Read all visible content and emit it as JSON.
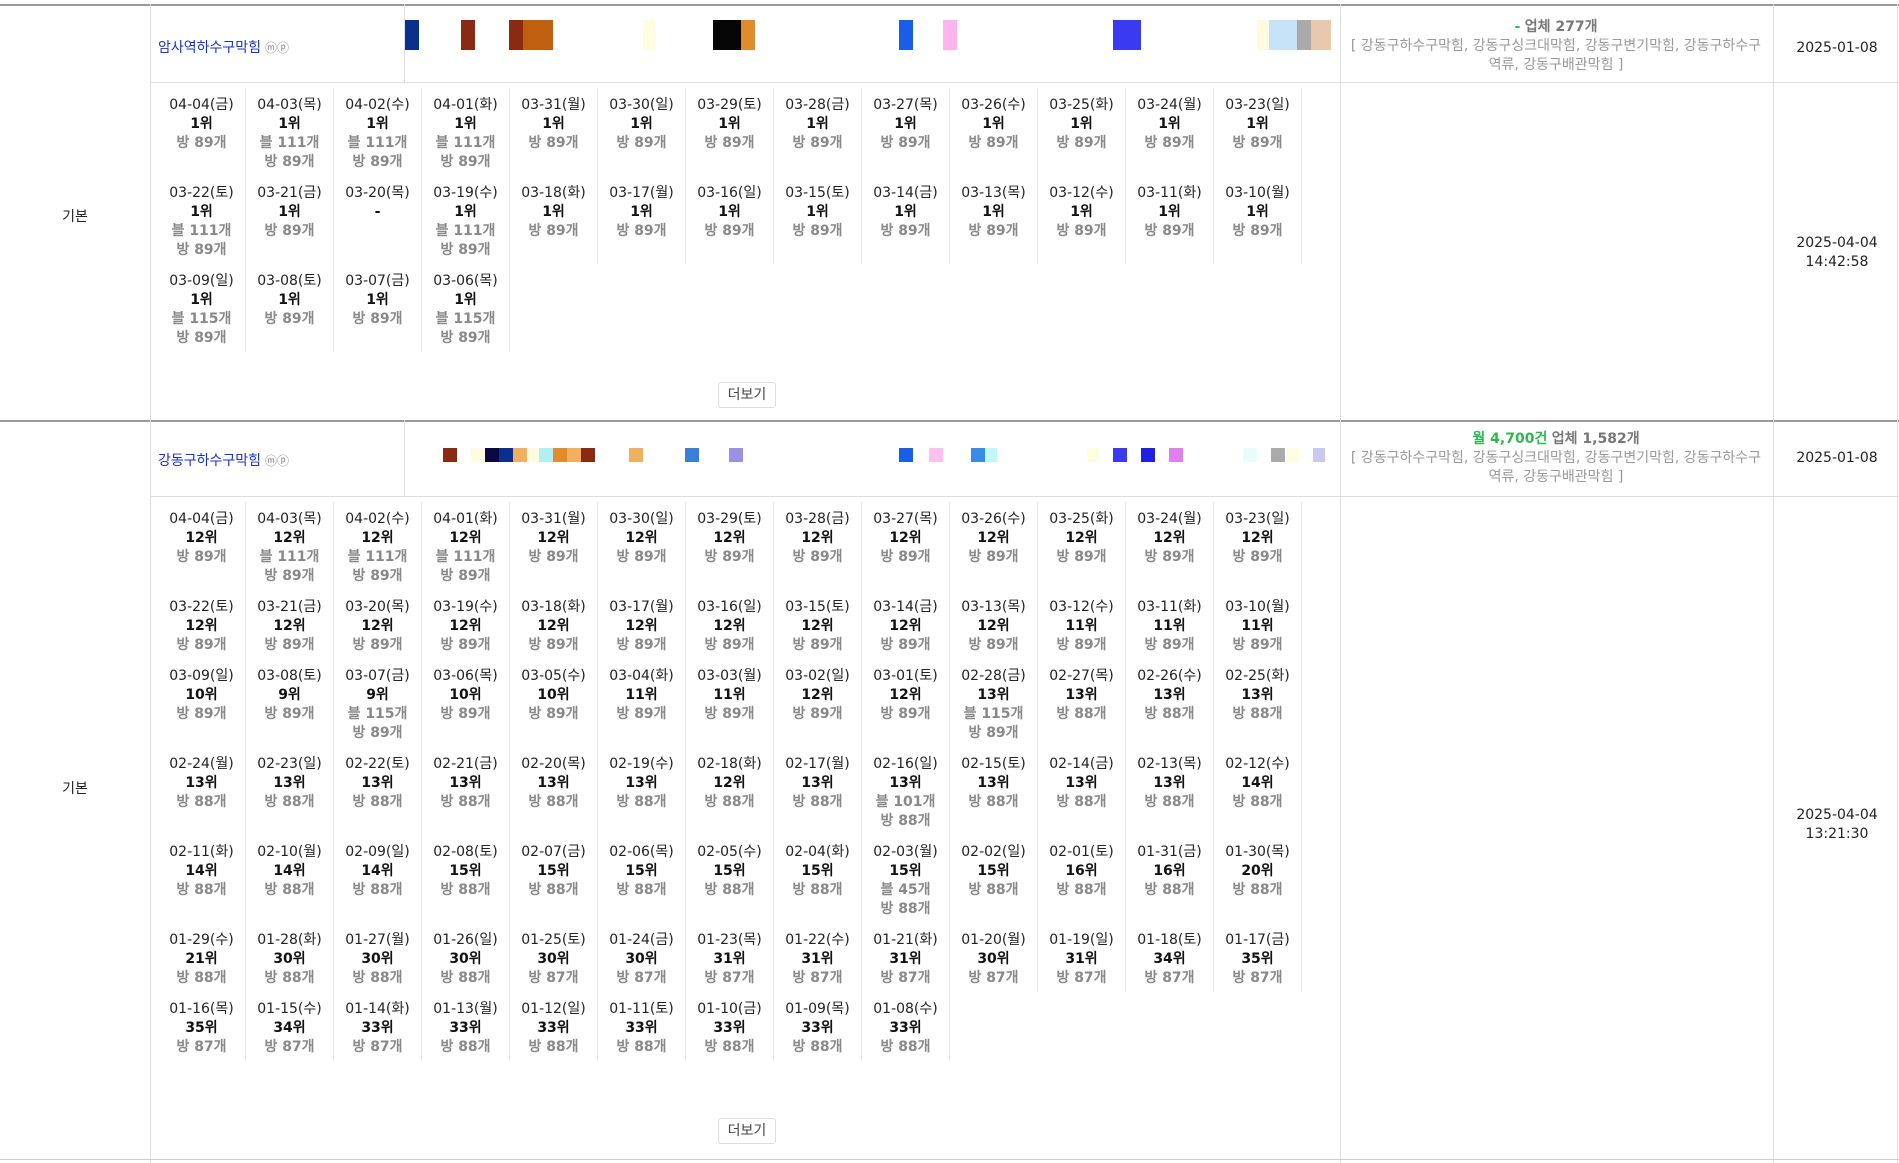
{
  "sections": [
    {
      "label": "기본",
      "keyword": "암사역하수구막힘",
      "mark": "ⓜⓟ",
      "summary_prefix": "-",
      "summary_count": "업체 277개",
      "tags": "[ 강동구하수구막힘, 강동구싱크대막힘, 강동구변기막힘, 강동구하수구역류, 강동구배관막힘 ]",
      "reg_date": "2025-01-08",
      "updated_date": "2025-04-04",
      "updated_time": "14:42:58",
      "more_label": "더보기",
      "strip": [
        {
          "c": "#0a2f8c",
          "w": 14,
          "o": 0
        },
        {
          "c": "#8b2a12",
          "w": 14,
          "o": 56
        },
        {
          "c": "#8b2a12",
          "w": 14,
          "o": 104
        },
        {
          "c": "#c0600e",
          "w": 30,
          "o": 118
        },
        {
          "c": "#fffde0",
          "w": 12,
          "o": 238
        },
        {
          "c": "#050505",
          "w": 28,
          "o": 308
        },
        {
          "c": "#e08b2c",
          "w": 14,
          "o": 336
        },
        {
          "c": "#1a5ee8",
          "w": 14,
          "o": 494
        },
        {
          "c": "#ffb3ef",
          "w": 14,
          "o": 538
        },
        {
          "c": "#3a3af0",
          "w": 28,
          "o": 708
        },
        {
          "c": "#fffbe0",
          "w": 12,
          "o": 852
        },
        {
          "c": "#c6e2f7",
          "w": 28,
          "o": 864
        },
        {
          "c": "#aaaaaa",
          "w": 14,
          "o": 892
        },
        {
          "c": "#e8c9b0",
          "w": 20,
          "o": 906
        }
      ],
      "cells": [
        {
          "d": "04-04(금)",
          "r": "1위",
          "l": [
            "방 89개"
          ]
        },
        {
          "d": "04-03(목)",
          "r": "1위",
          "l": [
            "블 111개",
            "방 89개"
          ]
        },
        {
          "d": "04-02(수)",
          "r": "1위",
          "l": [
            "블 111개",
            "방 89개"
          ]
        },
        {
          "d": "04-01(화)",
          "r": "1위",
          "l": [
            "블 111개",
            "방 89개"
          ]
        },
        {
          "d": "03-31(월)",
          "r": "1위",
          "l": [
            "방 89개"
          ]
        },
        {
          "d": "03-30(일)",
          "r": "1위",
          "l": [
            "방 89개"
          ]
        },
        {
          "d": "03-29(토)",
          "r": "1위",
          "l": [
            "방 89개"
          ]
        },
        {
          "d": "03-28(금)",
          "r": "1위",
          "l": [
            "방 89개"
          ]
        },
        {
          "d": "03-27(목)",
          "r": "1위",
          "l": [
            "방 89개"
          ]
        },
        {
          "d": "03-26(수)",
          "r": "1위",
          "l": [
            "방 89개"
          ]
        },
        {
          "d": "03-25(화)",
          "r": "1위",
          "l": [
            "방 89개"
          ]
        },
        {
          "d": "03-24(월)",
          "r": "1위",
          "l": [
            "방 89개"
          ]
        },
        {
          "d": "03-23(일)",
          "r": "1위",
          "l": [
            "방 89개"
          ]
        },
        {
          "d": "03-22(토)",
          "r": "1위",
          "l": [
            "블 111개",
            "방 89개"
          ]
        },
        {
          "d": "03-21(금)",
          "r": "1위",
          "l": [
            "방 89개"
          ]
        },
        {
          "d": "03-20(목)",
          "r": "-",
          "l": []
        },
        {
          "d": "03-19(수)",
          "r": "1위",
          "l": [
            "블 111개",
            "방 89개"
          ]
        },
        {
          "d": "03-18(화)",
          "r": "1위",
          "l": [
            "방 89개"
          ]
        },
        {
          "d": "03-17(월)",
          "r": "1위",
          "l": [
            "방 89개"
          ]
        },
        {
          "d": "03-16(일)",
          "r": "1위",
          "l": [
            "방 89개"
          ]
        },
        {
          "d": "03-15(토)",
          "r": "1위",
          "l": [
            "방 89개"
          ]
        },
        {
          "d": "03-14(금)",
          "r": "1위",
          "l": [
            "방 89개"
          ]
        },
        {
          "d": "03-13(목)",
          "r": "1위",
          "l": [
            "방 89개"
          ]
        },
        {
          "d": "03-12(수)",
          "r": "1위",
          "l": [
            "방 89개"
          ]
        },
        {
          "d": "03-11(화)",
          "r": "1위",
          "l": [
            "방 89개"
          ]
        },
        {
          "d": "03-10(월)",
          "r": "1위",
          "l": [
            "방 89개"
          ]
        },
        {
          "d": "03-09(일)",
          "r": "1위",
          "l": [
            "블 115개",
            "방 89개"
          ]
        },
        {
          "d": "03-08(토)",
          "r": "1위",
          "l": [
            "방 89개"
          ]
        },
        {
          "d": "03-07(금)",
          "r": "1위",
          "l": [
            "방 89개"
          ]
        },
        {
          "d": "03-06(목)",
          "r": "1위",
          "l": [
            "블 115개",
            "방 89개"
          ]
        }
      ]
    },
    {
      "label": "기본",
      "keyword": "강동구하수구막힘",
      "mark": "ⓜⓟ",
      "summary_prefix": "월 4,700건",
      "summary_count": "업체 1,582개",
      "tags": "[ 강동구하수구막힘, 강동구싱크대막힘, 강동구변기막힘, 강동구하수구역류, 강동구배관막힘 ]",
      "reg_date": "2025-01-08",
      "updated_date": "2025-04-04",
      "updated_time": "13:21:30",
      "more_label": "더보기",
      "strip": [
        {
          "c": "#8b2a12",
          "w": 14,
          "o": 38
        },
        {
          "c": "#fffbe0",
          "w": 14,
          "o": 66
        },
        {
          "c": "#0a0a40",
          "w": 14,
          "o": 80
        },
        {
          "c": "#0a2f8c",
          "w": 14,
          "o": 94
        },
        {
          "c": "#f0b060",
          "w": 14,
          "o": 108
        },
        {
          "c": "#fffbe0",
          "w": 12,
          "o": 122
        },
        {
          "c": "#b0f0f0",
          "w": 14,
          "o": 134
        },
        {
          "c": "#e08b2c",
          "w": 14,
          "o": 148
        },
        {
          "c": "#f0b060",
          "w": 14,
          "o": 162
        },
        {
          "c": "#8b2a12",
          "w": 14,
          "o": 176
        },
        {
          "c": "#f0b060",
          "w": 14,
          "o": 224
        },
        {
          "c": "#3a80d8",
          "w": 14,
          "o": 280
        },
        {
          "c": "#9a90e8",
          "w": 14,
          "o": 324
        },
        {
          "c": "#1a5ee8",
          "w": 14,
          "o": 494
        },
        {
          "c": "#ffc0f0",
          "w": 14,
          "o": 524
        },
        {
          "c": "#3a8ae8",
          "w": 14,
          "o": 566
        },
        {
          "c": "#c0f8f8",
          "w": 12,
          "o": 580
        },
        {
          "c": "#fffde0",
          "w": 12,
          "o": 682
        },
        {
          "c": "#3a3af0",
          "w": 14,
          "o": 708
        },
        {
          "c": "#2020e0",
          "w": 14,
          "o": 736
        },
        {
          "c": "#e080f0",
          "w": 14,
          "o": 764
        },
        {
          "c": "#e8fcfc",
          "w": 14,
          "o": 838
        },
        {
          "c": "#aaaaaa",
          "w": 14,
          "o": 866
        },
        {
          "c": "#fffde0",
          "w": 12,
          "o": 882
        },
        {
          "c": "#c8c8f0",
          "w": 12,
          "o": 908
        }
      ],
      "cells": [
        {
          "d": "04-04(금)",
          "r": "12위",
          "l": [
            "방 89개"
          ]
        },
        {
          "d": "04-03(목)",
          "r": "12위",
          "l": [
            "블 111개",
            "방 89개"
          ]
        },
        {
          "d": "04-02(수)",
          "r": "12위",
          "l": [
            "블 111개",
            "방 89개"
          ]
        },
        {
          "d": "04-01(화)",
          "r": "12위",
          "l": [
            "블 111개",
            "방 89개"
          ]
        },
        {
          "d": "03-31(월)",
          "r": "12위",
          "l": [
            "방 89개"
          ]
        },
        {
          "d": "03-30(일)",
          "r": "12위",
          "l": [
            "방 89개"
          ]
        },
        {
          "d": "03-29(토)",
          "r": "12위",
          "l": [
            "방 89개"
          ]
        },
        {
          "d": "03-28(금)",
          "r": "12위",
          "l": [
            "방 89개"
          ]
        },
        {
          "d": "03-27(목)",
          "r": "12위",
          "l": [
            "방 89개"
          ]
        },
        {
          "d": "03-26(수)",
          "r": "12위",
          "l": [
            "방 89개"
          ]
        },
        {
          "d": "03-25(화)",
          "r": "12위",
          "l": [
            "방 89개"
          ]
        },
        {
          "d": "03-24(월)",
          "r": "12위",
          "l": [
            "방 89개"
          ]
        },
        {
          "d": "03-23(일)",
          "r": "12위",
          "l": [
            "방 89개"
          ]
        },
        {
          "d": "03-22(토)",
          "r": "12위",
          "l": [
            "방 89개"
          ]
        },
        {
          "d": "03-21(금)",
          "r": "12위",
          "l": [
            "방 89개"
          ]
        },
        {
          "d": "03-20(목)",
          "r": "12위",
          "l": [
            "방 89개"
          ]
        },
        {
          "d": "03-19(수)",
          "r": "12위",
          "l": [
            "방 89개"
          ]
        },
        {
          "d": "03-18(화)",
          "r": "12위",
          "l": [
            "방 89개"
          ]
        },
        {
          "d": "03-17(월)",
          "r": "12위",
          "l": [
            "방 89개"
          ]
        },
        {
          "d": "03-16(일)",
          "r": "12위",
          "l": [
            "방 89개"
          ]
        },
        {
          "d": "03-15(토)",
          "r": "12위",
          "l": [
            "방 89개"
          ]
        },
        {
          "d": "03-14(금)",
          "r": "12위",
          "l": [
            "방 89개"
          ]
        },
        {
          "d": "03-13(목)",
          "r": "12위",
          "l": [
            "방 89개"
          ]
        },
        {
          "d": "03-12(수)",
          "r": "11위",
          "l": [
            "방 89개"
          ]
        },
        {
          "d": "03-11(화)",
          "r": "11위",
          "l": [
            "방 89개"
          ]
        },
        {
          "d": "03-10(월)",
          "r": "11위",
          "l": [
            "방 89개"
          ]
        },
        {
          "d": "03-09(일)",
          "r": "10위",
          "l": [
            "방 89개"
          ]
        },
        {
          "d": "03-08(토)",
          "r": "9위",
          "l": [
            "방 89개"
          ]
        },
        {
          "d": "03-07(금)",
          "r": "9위",
          "l": [
            "블 115개",
            "방 89개"
          ]
        },
        {
          "d": "03-06(목)",
          "r": "10위",
          "l": [
            "방 89개"
          ]
        },
        {
          "d": "03-05(수)",
          "r": "10위",
          "l": [
            "방 89개"
          ]
        },
        {
          "d": "03-04(화)",
          "r": "11위",
          "l": [
            "방 89개"
          ]
        },
        {
          "d": "03-03(월)",
          "r": "11위",
          "l": [
            "방 89개"
          ]
        },
        {
          "d": "03-02(일)",
          "r": "12위",
          "l": [
            "방 89개"
          ]
        },
        {
          "d": "03-01(토)",
          "r": "12위",
          "l": [
            "방 89개"
          ]
        },
        {
          "d": "02-28(금)",
          "r": "13위",
          "l": [
            "블 115개",
            "방 89개"
          ]
        },
        {
          "d": "02-27(목)",
          "r": "13위",
          "l": [
            "방 88개"
          ]
        },
        {
          "d": "02-26(수)",
          "r": "13위",
          "l": [
            "방 88개"
          ]
        },
        {
          "d": "02-25(화)",
          "r": "13위",
          "l": [
            "방 88개"
          ]
        },
        {
          "d": "02-24(월)",
          "r": "13위",
          "l": [
            "방 88개"
          ]
        },
        {
          "d": "02-23(일)",
          "r": "13위",
          "l": [
            "방 88개"
          ]
        },
        {
          "d": "02-22(토)",
          "r": "13위",
          "l": [
            "방 88개"
          ]
        },
        {
          "d": "02-21(금)",
          "r": "13위",
          "l": [
            "방 88개"
          ]
        },
        {
          "d": "02-20(목)",
          "r": "13위",
          "l": [
            "방 88개"
          ]
        },
        {
          "d": "02-19(수)",
          "r": "13위",
          "l": [
            "방 88개"
          ]
        },
        {
          "d": "02-18(화)",
          "r": "12위",
          "l": [
            "방 88개"
          ]
        },
        {
          "d": "02-17(월)",
          "r": "13위",
          "l": [
            "방 88개"
          ]
        },
        {
          "d": "02-16(일)",
          "r": "13위",
          "l": [
            "블 101개",
            "방 88개"
          ]
        },
        {
          "d": "02-15(토)",
          "r": "13위",
          "l": [
            "방 88개"
          ]
        },
        {
          "d": "02-14(금)",
          "r": "13위",
          "l": [
            "방 88개"
          ]
        },
        {
          "d": "02-13(목)",
          "r": "13위",
          "l": [
            "방 88개"
          ]
        },
        {
          "d": "02-12(수)",
          "r": "14위",
          "l": [
            "방 88개"
          ]
        },
        {
          "d": "02-11(화)",
          "r": "14위",
          "l": [
            "방 88개"
          ]
        },
        {
          "d": "02-10(월)",
          "r": "14위",
          "l": [
            "방 88개"
          ]
        },
        {
          "d": "02-09(일)",
          "r": "14위",
          "l": [
            "방 88개"
          ]
        },
        {
          "d": "02-08(토)",
          "r": "15위",
          "l": [
            "방 88개"
          ]
        },
        {
          "d": "02-07(금)",
          "r": "15위",
          "l": [
            "방 88개"
          ]
        },
        {
          "d": "02-06(목)",
          "r": "15위",
          "l": [
            "방 88개"
          ]
        },
        {
          "d": "02-05(수)",
          "r": "15위",
          "l": [
            "방 88개"
          ]
        },
        {
          "d": "02-04(화)",
          "r": "15위",
          "l": [
            "방 88개"
          ]
        },
        {
          "d": "02-03(월)",
          "r": "15위",
          "l": [
            "블 45개",
            "방 88개"
          ]
        },
        {
          "d": "02-02(일)",
          "r": "15위",
          "l": [
            "방 88개"
          ]
        },
        {
          "d": "02-01(토)",
          "r": "16위",
          "l": [
            "방 88개"
          ]
        },
        {
          "d": "01-31(금)",
          "r": "16위",
          "l": [
            "방 88개"
          ]
        },
        {
          "d": "01-30(목)",
          "r": "20위",
          "l": [
            "방 88개"
          ]
        },
        {
          "d": "01-29(수)",
          "r": "21위",
          "l": [
            "방 88개"
          ]
        },
        {
          "d": "01-28(화)",
          "r": "30위",
          "l": [
            "방 88개"
          ]
        },
        {
          "d": "01-27(월)",
          "r": "30위",
          "l": [
            "방 88개"
          ]
        },
        {
          "d": "01-26(일)",
          "r": "30위",
          "l": [
            "방 88개"
          ]
        },
        {
          "d": "01-25(토)",
          "r": "30위",
          "l": [
            "방 87개"
          ]
        },
        {
          "d": "01-24(금)",
          "r": "30위",
          "l": [
            "방 87개"
          ]
        },
        {
          "d": "01-23(목)",
          "r": "31위",
          "l": [
            "방 87개"
          ]
        },
        {
          "d": "01-22(수)",
          "r": "31위",
          "l": [
            "방 87개"
          ]
        },
        {
          "d": "01-21(화)",
          "r": "31위",
          "l": [
            "방 87개"
          ]
        },
        {
          "d": "01-20(월)",
          "r": "30위",
          "l": [
            "방 87개"
          ]
        },
        {
          "d": "01-19(일)",
          "r": "31위",
          "l": [
            "방 87개"
          ]
        },
        {
          "d": "01-18(토)",
          "r": "34위",
          "l": [
            "방 87개"
          ]
        },
        {
          "d": "01-17(금)",
          "r": "35위",
          "l": [
            "방 87개"
          ]
        },
        {
          "d": "01-16(목)",
          "r": "35위",
          "l": [
            "방 87개"
          ]
        },
        {
          "d": "01-15(수)",
          "r": "34위",
          "l": [
            "방 87개"
          ]
        },
        {
          "d": "01-14(화)",
          "r": "33위",
          "l": [
            "방 87개"
          ]
        },
        {
          "d": "01-13(월)",
          "r": "33위",
          "l": [
            "방 88개"
          ]
        },
        {
          "d": "01-12(일)",
          "r": "33위",
          "l": [
            "방 88개"
          ]
        },
        {
          "d": "01-11(토)",
          "r": "33위",
          "l": [
            "방 88개"
          ]
        },
        {
          "d": "01-10(금)",
          "r": "33위",
          "l": [
            "방 88개"
          ]
        },
        {
          "d": "01-09(목)",
          "r": "33위",
          "l": [
            "방 88개"
          ]
        },
        {
          "d": "01-08(수)",
          "r": "33위",
          "l": [
            "방 88개"
          ]
        }
      ]
    }
  ]
}
